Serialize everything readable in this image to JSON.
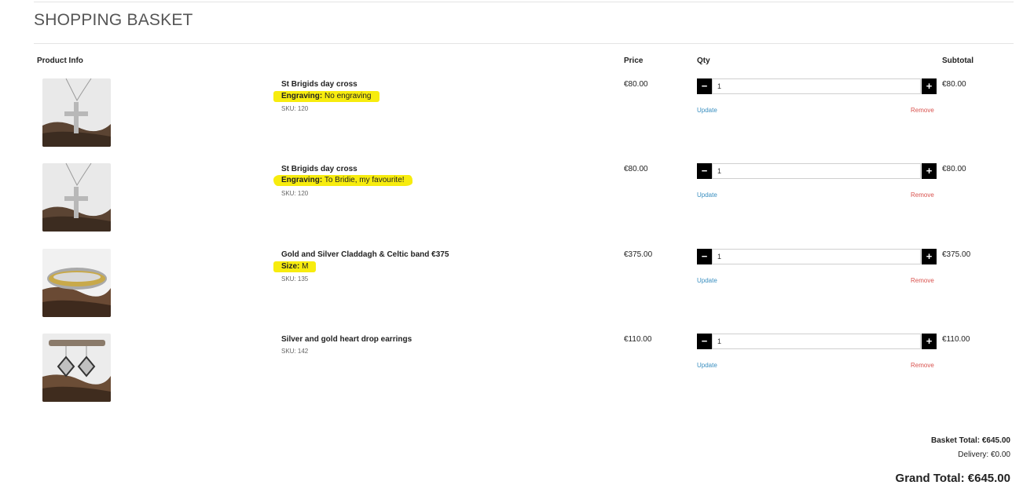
{
  "page": {
    "title": "SHOPPING BASKET"
  },
  "table_headers": {
    "product_info": "Product Info",
    "price": "Price",
    "qty": "Qty",
    "subtotal": "Subtotal"
  },
  "items": [
    {
      "name": "St Brigids day cross",
      "attr_label": "Engraving:",
      "attr_value": " No engraving",
      "sku": "SKU: 120",
      "price": "€80.00",
      "qty": "1",
      "subtotal": "€80.00",
      "update": "Update",
      "remove": "Remove"
    },
    {
      "name": "St Brigids day cross",
      "attr_label": "Engraving:",
      "attr_value": " To Bridie, my favourite!",
      "sku": "SKU: 120",
      "price": "€80.00",
      "qty": "1",
      "subtotal": "€80.00",
      "update": "Update",
      "remove": "Remove"
    },
    {
      "name": "Gold and Silver Claddagh & Celtic band €375",
      "attr_label": "Size:",
      "attr_value": " M",
      "sku": "SKU: 135",
      "price": "€375.00",
      "qty": "1",
      "subtotal": "€375.00",
      "update": "Update",
      "remove": "Remove"
    },
    {
      "name": "Silver and gold heart drop earrings",
      "sku": "SKU: 142",
      "price": "€110.00",
      "qty": "1",
      "subtotal": "€110.00",
      "update": "Update",
      "remove": "Remove"
    }
  ],
  "totals": {
    "basket_total": "Basket Total: €645.00",
    "delivery": "Delivery: €0.00",
    "grand_total": "Grand Total: €645.00"
  },
  "qty_controls": {
    "minus": "−",
    "plus": "+"
  },
  "colors": {
    "highlight": "#f7ec0e",
    "update_link": "#3a8fc0",
    "remove_link": "#d9534f"
  },
  "icons": {
    "minus": "minus-icon",
    "plus": "plus-icon"
  }
}
